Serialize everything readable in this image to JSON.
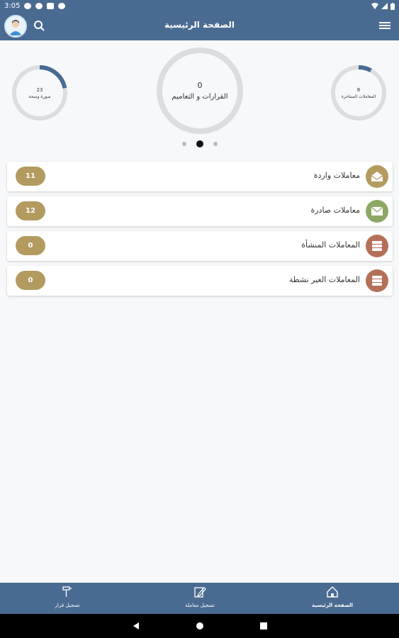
{
  "status_bar": {
    "time": "3:05"
  },
  "app_bar": {
    "title": "الصفحة الرئيسية"
  },
  "stats": {
    "left": {
      "value": "23",
      "label": "صورة وسحة",
      "progress": 0.22
    },
    "center": {
      "value": "0",
      "label": "القرارات و التعاميم",
      "progress": 0
    },
    "right": {
      "value": "8",
      "label": "المعاملات المنتاخرة",
      "progress": 0.08
    },
    "pager": {
      "count": 3,
      "active": 1
    }
  },
  "list": [
    {
      "label": "معاملات واردة",
      "count": "11",
      "icon": "open-envelope-icon",
      "color": "#b39b5f"
    },
    {
      "label": "معاملات صادرة",
      "count": "12",
      "icon": "envelope-icon",
      "color": "#8da865"
    },
    {
      "label": "المعاملات المنشأة",
      "count": "0",
      "icon": "list-icon",
      "color": "#b5705a"
    },
    {
      "label": "المعاملات الغير نشطة",
      "count": "0",
      "icon": "list-icon",
      "color": "#b5705a"
    }
  ],
  "bottom_nav": [
    {
      "label": "تسجيل قرار",
      "icon": "decree-icon"
    },
    {
      "label": "تسجيل معاملة",
      "icon": "edit-document-icon"
    },
    {
      "label": "الصفحة الرئيسية",
      "icon": "home-icon",
      "active": true
    }
  ],
  "colors": {
    "primary": "#4a6b91",
    "badge": "#b39b5f",
    "gauge_track": "#dcdde0",
    "gauge_fill": "#4a6b91"
  }
}
